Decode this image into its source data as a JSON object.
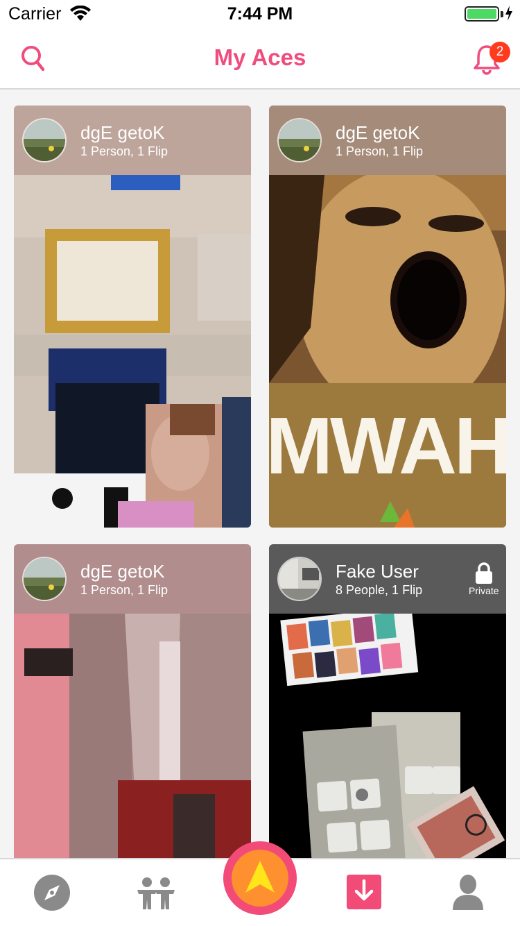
{
  "status_bar": {
    "carrier": "Carrier",
    "time": "7:44 PM",
    "battery_level": 1.0
  },
  "nav": {
    "title": "My Aces",
    "notification_count": "2",
    "accent_color": "#ef4d7d"
  },
  "cards": [
    {
      "name": "dgE getoK",
      "subtitle": "1 Person, 1 Flip",
      "private": false
    },
    {
      "name": "dgE getoK",
      "subtitle": "1 Person, 1 Flip",
      "private": false
    },
    {
      "name": "dgE getoK",
      "subtitle": "1 Person, 1 Flip",
      "private": false
    },
    {
      "name": "Fake User",
      "subtitle": "8 People, 1 Flip",
      "private": true,
      "private_label": "Private"
    }
  ],
  "card2_image_text": "MWAH",
  "tab_bar": {
    "items": [
      {
        "icon": "compass-icon"
      },
      {
        "icon": "people-icon"
      },
      {
        "icon": "arrow-up-fab-icon"
      },
      {
        "icon": "download-icon",
        "active": true
      },
      {
        "icon": "profile-icon"
      }
    ],
    "active_color": "#f24b78"
  }
}
